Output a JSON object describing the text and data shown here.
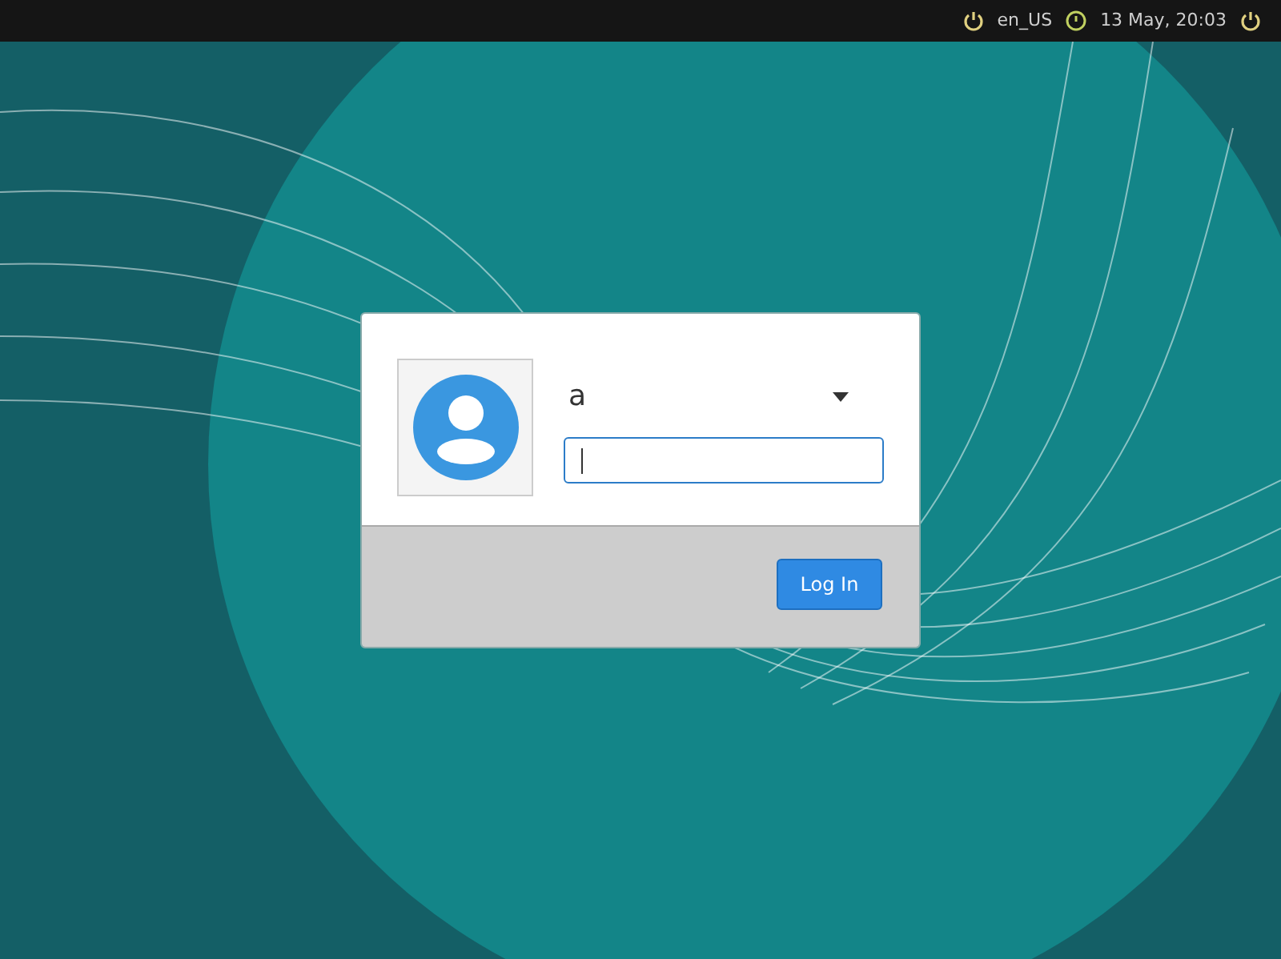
{
  "top_bar": {
    "keyboard_layout": "en_US",
    "date_time": "13 May, 20:03"
  },
  "login_dialog": {
    "username": "a",
    "password_field": {
      "focused": true
    },
    "login_button": "Log In"
  }
}
